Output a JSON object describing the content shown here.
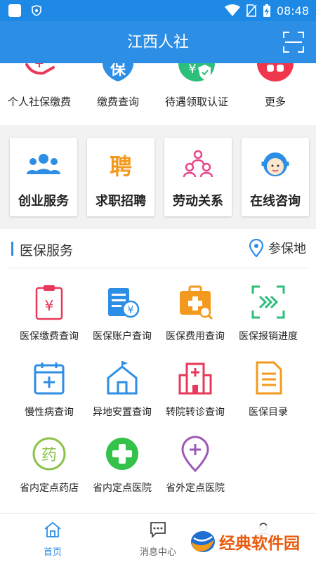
{
  "status_bar": {
    "time": "08:48",
    "icons": [
      "app-square-icon",
      "shield-icon",
      "wifi-icon",
      "no-sim-icon",
      "battery-charging-icon"
    ]
  },
  "app_bar": {
    "title": "江西人社",
    "scan_icon": "scan-icon"
  },
  "quick_actions": [
    {
      "label": "个人社保缴费",
      "icon": "yuan-hand-icon",
      "color": "#e8395a"
    },
    {
      "label": "缴费查询",
      "icon": "bao-shield-icon",
      "color": "#2d8ee6"
    },
    {
      "label": "待遇领取认证",
      "icon": "verified-person-icon",
      "color": "#2cbf7a"
    },
    {
      "label": "更多",
      "icon": "grid-more-icon",
      "color": "#f0364c"
    }
  ],
  "service_cards": [
    {
      "label": "创业服务",
      "icon": "team-icon",
      "color": "#2d8ee6"
    },
    {
      "label": "求职招聘",
      "icon": "hire-icon",
      "color": "#f39a1e",
      "icon_text": "聘"
    },
    {
      "label": "劳动关系",
      "icon": "people-tree-icon",
      "color": "#e8458b"
    },
    {
      "label": "在线咨询",
      "icon": "agent-icon",
      "color": "#2d8ee6"
    }
  ],
  "medical": {
    "title": "医保服务",
    "location_label": "参保地",
    "items": [
      {
        "label": "医保缴费查询",
        "icon": "clipboard-yuan-icon",
        "color": "#e8395a"
      },
      {
        "label": "医保账户查询",
        "icon": "account-card-icon",
        "color": "#2d8ee6"
      },
      {
        "label": "医保费用查询",
        "icon": "medkit-search-icon",
        "color": "#f39a1e"
      },
      {
        "label": "医保报销进度",
        "icon": "progress-scan-icon",
        "color": "#2cbf7a"
      },
      {
        "label": "慢性病查询",
        "icon": "calendar-plus-icon",
        "color": "#2d8ee6"
      },
      {
        "label": "异地安置查询",
        "icon": "house-flag-icon",
        "color": "#2d8ee6"
      },
      {
        "label": "转院转诊查询",
        "icon": "hospital-icon",
        "color": "#e8395a"
      },
      {
        "label": "医保目录",
        "icon": "document-list-icon",
        "color": "#f39a1e"
      },
      {
        "label": "省内定点药店",
        "icon": "pharmacy-icon",
        "color": "#8bc34a",
        "icon_text": "药"
      },
      {
        "label": "省内定点医院",
        "icon": "green-cross-icon",
        "color": "#35c24a"
      },
      {
        "label": "省外定点医院",
        "icon": "location-cross-icon",
        "color": "#9b59b6"
      }
    ]
  },
  "tab_bar": [
    {
      "label": "首页",
      "icon": "home-icon",
      "active": true
    },
    {
      "label": "消息中心",
      "icon": "message-icon",
      "active": false
    },
    {
      "label": "",
      "icon": "profile-icon",
      "active": false
    }
  ],
  "watermark": {
    "text": "经典软件园"
  }
}
